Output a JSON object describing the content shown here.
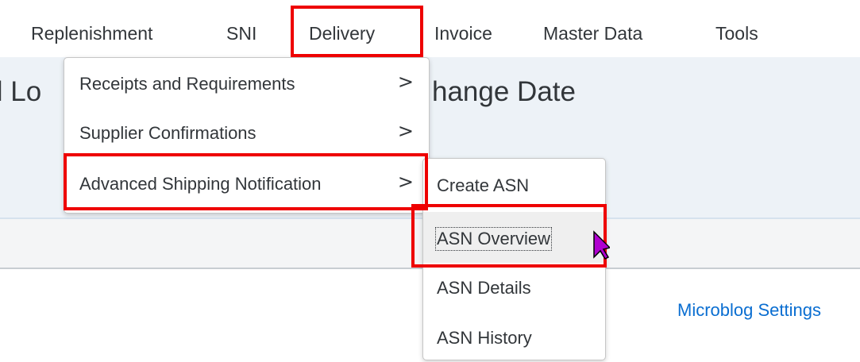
{
  "nav": {
    "items": [
      {
        "label": "Replenishment"
      },
      {
        "label": "SNI"
      },
      {
        "label": "Delivery"
      },
      {
        "label": "Invoice"
      },
      {
        "label": "Master Data"
      },
      {
        "label": "Tools"
      }
    ]
  },
  "page": {
    "title_left": "ll Lo",
    "title_right": "hange Date"
  },
  "delivery_menu": {
    "items": [
      {
        "label": "Receipts and Requirements",
        "chevron": ">"
      },
      {
        "label": "Supplier Confirmations",
        "chevron": ">"
      },
      {
        "label": "Advanced Shipping Notification",
        "chevron": ">"
      }
    ]
  },
  "asn_submenu": {
    "items": [
      {
        "label": "Create ASN"
      },
      {
        "label": "ASN Overview",
        "hovered": true
      },
      {
        "label": "ASN Details"
      },
      {
        "label": "ASN History"
      }
    ]
  },
  "footer": {
    "microblog_link": "Microblog Settings"
  },
  "colors": {
    "highlight": "#ee0000",
    "link": "#0a6ed1",
    "band": "#edf2f7",
    "cursor": "#b000d0"
  }
}
